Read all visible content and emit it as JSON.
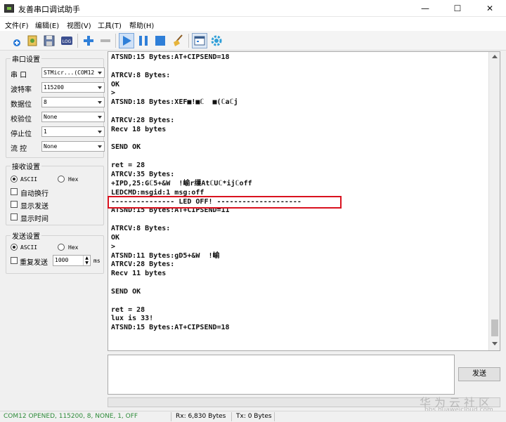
{
  "window": {
    "title": "友善串口调试助手",
    "controls": [
      "—",
      "☐",
      "✕"
    ]
  },
  "menu": [
    "文件(F)",
    "编辑(E)",
    "视图(V)",
    "工具(T)",
    "帮助(H)"
  ],
  "serial_settings": {
    "title": "串口设置",
    "fields": [
      {
        "label": "串  口",
        "value": "STMicr...(COM12"
      },
      {
        "label": "波特率",
        "value": "115200"
      },
      {
        "label": "数据位",
        "value": "8"
      },
      {
        "label": "校验位",
        "value": "None"
      },
      {
        "label": "停止位",
        "value": "1"
      },
      {
        "label": "流  控",
        "value": "None"
      }
    ]
  },
  "receive_settings": {
    "title": "接收设置",
    "ascii": "ASCII",
    "hex": "Hex",
    "auto_wrap": "自动换行",
    "show_send": "显示发送",
    "show_time": "显示时间"
  },
  "send_settings": {
    "title": "发送设置",
    "ascii": "ASCII",
    "hex": "Hex",
    "repeat": "重复发送",
    "interval": "1000",
    "unit": "ms"
  },
  "receive_lines": [
    "ATSND:15 Bytes:AT+CIPSEND=18",
    "",
    "ATRCV:8 Bytes:",
    "OK",
    ">",
    "ATSND:18 Bytes:XEF■!■ℂ  ■(ℂaℂj",
    "",
    "ATRCV:28 Bytes:",
    "Recv 18 bytes",
    "",
    "SEND OK",
    "",
    "ret = 28",
    "ATRCV:35 Bytes:",
    "+IPD,25:Gℂ5+&W  !崳r缫AtℂUℂ*ijℂoff",
    "LEDCMD:msgid:1 msg:off",
    "--------------- LED OFF! --------------------",
    "ATSND:15 Bytes:AT+CIPSEND=11",
    "",
    "ATRCV:8 Bytes:",
    "OK",
    ">",
    "ATSND:11 Bytes:gD5+&W  !崳",
    "ATRCV:28 Bytes:",
    "Recv 11 bytes",
    "",
    "SEND OK",
    "",
    "ret = 28",
    "lux is 33!",
    "ATSND:15 Bytes:AT+CIPSEND=18"
  ],
  "send_button": "发送",
  "watermark": {
    "main": "华为云社区",
    "sub": "bbs.huaweicloud.com"
  },
  "status": {
    "port": "COM12 OPENED, 115200, 8, NONE, 1, OFF",
    "rx": "Rx: 6,830 Bytes",
    "tx": "Tx: 0 Bytes"
  },
  "colors": {
    "highlight": "#d9121f",
    "status_port": "#2e8b3a",
    "accent": "#2f7fd8"
  }
}
